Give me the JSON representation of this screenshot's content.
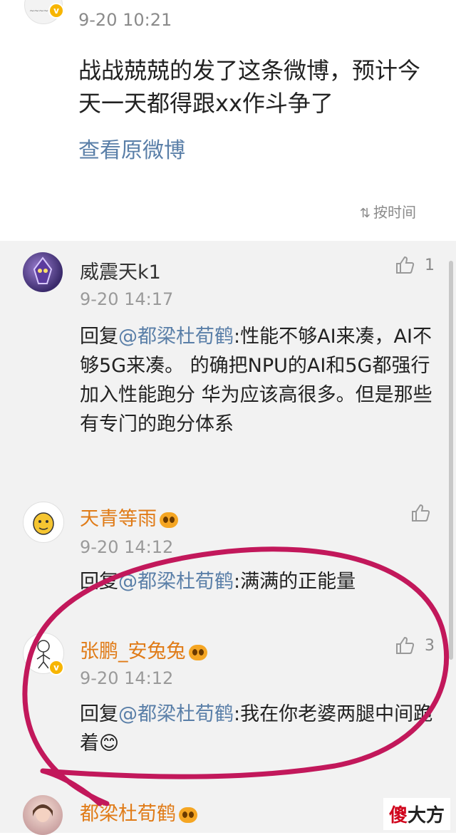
{
  "post": {
    "time": "9-20 10:21",
    "content": "战战兢兢的发了这条微博，预计今天一天都得跟xx作斗争了",
    "view_original": "查看原微博",
    "sort_label": "按时间",
    "sort_icon": "sort-time-icon"
  },
  "comments": [
    {
      "username": "威震天k1",
      "username_color": "#333333",
      "time": "9-20 14:17",
      "reply_prefix": "回复",
      "mention": "@都梁杜荀鹤",
      "text": ":性能不够AI来凑，AI不够5G来凑。 的确把NPU的AI和5G都强行加入性能跑分 华为应该高很多。但是那些有专门的跑分体系",
      "likes": "1",
      "has_fan_badge": false
    },
    {
      "username": "天青等雨",
      "username_color": "#e07b17",
      "time": "9-20 14:12",
      "reply_prefix": "回复",
      "mention": "@都梁杜荀鹤",
      "text": ":满满的正能量",
      "likes": "",
      "has_fan_badge": true
    },
    {
      "username": "张鹏_安兔兔",
      "username_color": "#e07b17",
      "time": "9-20 14:12",
      "reply_prefix": "回复",
      "mention": "@都梁杜荀鹤",
      "text": ":我在你老婆两腿中间跪着😊",
      "likes": "3",
      "has_fan_badge": true
    },
    {
      "username": "都梁杜荀鹤",
      "username_color": "#e07b17",
      "has_fan_badge": true
    }
  ],
  "watermark": {
    "red_char": "傻",
    "rest": "大方"
  },
  "colors": {
    "link": "#5a7fa8",
    "orange_name": "#e07b17",
    "annotation_circle": "#c2185b"
  }
}
